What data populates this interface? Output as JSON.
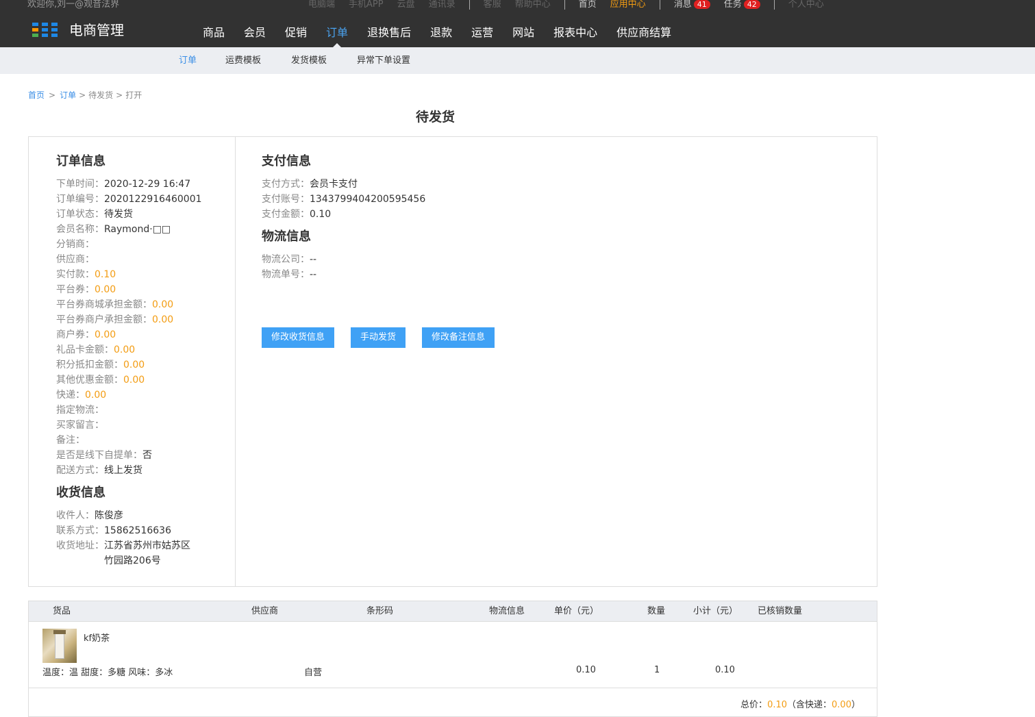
{
  "topbar": {
    "welcome": "欢迎你,刘一@观音法界",
    "links": [
      {
        "label": "电脑端",
        "style": "dim"
      },
      {
        "label": "手机APP",
        "style": "dim"
      },
      {
        "label": "云盘",
        "style": "dim"
      },
      {
        "label": "通讯录",
        "style": "dim"
      },
      {
        "label": "|",
        "style": "sep"
      },
      {
        "label": "客服",
        "style": "dim"
      },
      {
        "label": "帮助中心",
        "style": "dim"
      },
      {
        "label": "|",
        "style": "sep"
      },
      {
        "label": "首页",
        "style": "bright"
      },
      {
        "label": "应用中心",
        "style": "accent"
      },
      {
        "label": "|",
        "style": "sep"
      },
      {
        "label": "消息",
        "style": "bright",
        "badge": "41"
      },
      {
        "label": "任务",
        "style": "bright",
        "badge": "42"
      },
      {
        "label": "|",
        "style": "sep"
      },
      {
        "label": "个人中心",
        "style": "dim"
      }
    ]
  },
  "logo": {
    "title": "电商管理",
    "colors": [
      "#1e88e5",
      "#ff9800",
      "#4caf50"
    ]
  },
  "mainnav": {
    "items": [
      "商品",
      "会员",
      "促销",
      "订单",
      "退换售后",
      "退款",
      "运营",
      "网站",
      "报表中心",
      "供应商结算"
    ],
    "active": "订单"
  },
  "subnav": {
    "items": [
      "订单",
      "运费模板",
      "发货模板",
      "异常下单设置"
    ],
    "active": "订单"
  },
  "breadcrumb": {
    "home": "首页",
    "order": "订单",
    "gt1": ">",
    "gt2": ">",
    "gt3": ">",
    "pending": "待发货",
    "current": "打开"
  },
  "page_title": "待发货",
  "order_info": {
    "title": "订单信息",
    "rows": [
      {
        "k": "下单时间：",
        "v": "2020-12-29 16:47",
        "orange": false
      },
      {
        "k": "订单编号：",
        "v": "2020122916460001",
        "orange": false
      },
      {
        "k": "订单状态：",
        "v": "待发货",
        "orange": false
      },
      {
        "k": "会员名称：",
        "v": "Raymond·□□",
        "orange": false
      },
      {
        "k": "分销商：",
        "v": "",
        "orange": false
      },
      {
        "k": "供应商：",
        "v": "",
        "orange": false
      },
      {
        "k": "实付款：",
        "v": "0.10",
        "orange": true
      },
      {
        "k": "平台券：",
        "v": "0.00",
        "orange": true
      },
      {
        "k": "平台券商城承担金额：",
        "v": "0.00",
        "orange": true
      },
      {
        "k": "平台券商户承担金额：",
        "v": "0.00",
        "orange": true
      },
      {
        "k": "商户券：",
        "v": "0.00",
        "orange": true
      },
      {
        "k": "礼品卡金额：",
        "v": "0.00",
        "orange": true
      },
      {
        "k": "积分抵扣金额：",
        "v": "0.00",
        "orange": true
      },
      {
        "k": "其他优惠金额：",
        "v": "0.00",
        "orange": true
      },
      {
        "k": "快递：",
        "v": "0.00",
        "orange": true
      },
      {
        "k": "指定物流：",
        "v": "",
        "orange": false
      },
      {
        "k": "买家留言：",
        "v": "",
        "orange": false
      },
      {
        "k": "备注：",
        "v": "",
        "orange": false
      },
      {
        "k": "是否是线下自提单：",
        "v": "否",
        "orange": false
      },
      {
        "k": "配送方式：",
        "v": "线上发货",
        "orange": false
      }
    ]
  },
  "receive_info": {
    "title": "收货信息",
    "rows": [
      {
        "k": "收件人：",
        "v": "陈俊彦"
      },
      {
        "k": "联系方式：",
        "v": "15862516636"
      },
      {
        "k": "收货地址：",
        "v": "江苏省苏州市姑苏区",
        "v2": "竹园路206号"
      }
    ]
  },
  "pay_info": {
    "title": "支付信息",
    "rows": [
      {
        "k": "支付方式：",
        "v": "会员卡支付"
      },
      {
        "k": "支付账号：",
        "v": "1343799404200595456"
      },
      {
        "k": "支付金额：",
        "v": "0.10"
      }
    ]
  },
  "logistics_info": {
    "title": "物流信息",
    "rows": [
      {
        "k": "物流公司：",
        "v": "--"
      },
      {
        "k": "物流单号：",
        "v": "--"
      }
    ]
  },
  "actions": {
    "edit_address": "修改收货信息",
    "manual_ship": "手动发货",
    "edit_remark": "修改备注信息"
  },
  "goods": {
    "headers": {
      "goods": "货品",
      "supplier": "供应商",
      "barcode": "条形码",
      "logistics": "物流信息",
      "price": "单价（元）",
      "qty": "数量",
      "subtotal": "小计（元）",
      "verified": "已核销数量"
    },
    "item": {
      "name": "kf奶茶",
      "spec": "温度：温 甜度：多糖 风味：多冰",
      "supplier": "自营",
      "price": "0.10",
      "qty": "1",
      "subtotal": "0.10"
    },
    "total": {
      "label": "总价：",
      "value": "0.10",
      "mid": "（含快递：",
      "shipping": "0.00",
      "end": "）"
    }
  }
}
